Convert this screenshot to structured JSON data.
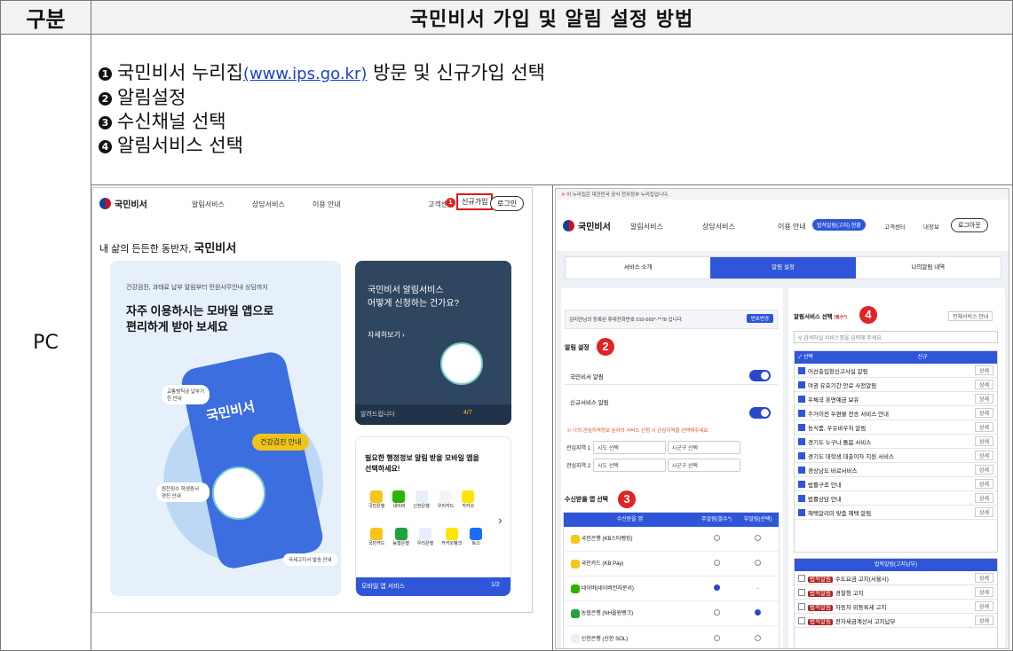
{
  "header": {
    "col1": "구분",
    "col2": "국민비서 가입 및 알림 설정 방법"
  },
  "row_label": "PC",
  "steps": [
    {
      "num": "1",
      "before": "국민비서 누리집",
      "link": "(www.ips.go.kr)",
      "after": " 방문 및 신규가입 선택"
    },
    {
      "num": "2",
      "before": "알림설정",
      "link": "",
      "after": ""
    },
    {
      "num": "3",
      "before": "수신채널 선택",
      "link": "",
      "after": ""
    },
    {
      "num": "4",
      "before": "알림서비스 선택",
      "link": "",
      "after": ""
    }
  ],
  "shot1": {
    "logo": "국민비서",
    "nav": [
      "알림서비스",
      "상담서비스",
      "이용 안내"
    ],
    "customer_center": "고객센터",
    "signup": "신규가입",
    "login": "로그인",
    "badge": "1",
    "tagline_prefix": "내 삶의 든든한 동반자, ",
    "tagline_brand": "국민비서",
    "hero_small": "건강검진, 과태료 납부 알림부터 민원사무안내 상담까지",
    "hero_line1": "자주 이용하시는 모바일 앱으로",
    "hero_line2": "편리하게 받아 보세요",
    "phone_title": "국민비서",
    "bubble_health": "건강검진 안내",
    "bubble_traffic": "교통범칙금 납부기한 안내",
    "bubble_loan": "원천징수 학생증서 경진 안내",
    "bubble_tax": "국세고지서 발송 안내",
    "dark_card_line1": "국민비서 알림서비스",
    "dark_card_line2": "어떻게 신청하는 건가요?",
    "dark_card_more": "자세히보기 ›",
    "dark_card_footer": "알려드립니다",
    "dark_card_page": "4/7",
    "apps_title1": "필요한 행정정보 알림 받을 모바일 앱을",
    "apps_title2": "선택하세요!",
    "apps_row1": [
      "국민은행",
      "네이버",
      "신한은행",
      "우리카드",
      "카카오"
    ],
    "apps_row2": [
      "국민카드",
      "농협은행",
      "우리은행",
      "카카오뱅크",
      "토스"
    ],
    "apps_footer": "모바일 앱 서비스",
    "apps_page": "1/2"
  },
  "shot2": {
    "topbar": "이 누리집은 대한민국 공식 전자정부 누리집입니다.",
    "logo": "국민비서",
    "nav": [
      "알림서비스",
      "상담서비스",
      "이용 안내"
    ],
    "notice_btn": "법적알림(고지) 현황",
    "right_nav": [
      "고객센터",
      "내정보"
    ],
    "logout": "로그아웃",
    "tabs": [
      "서비스 소개",
      "알림 설정",
      "나의알림 내역"
    ],
    "phone_info": "김미연님의 등록된 휴대전화번호 010-569*-**78 입니다.",
    "phone_change": "번호변경",
    "alarm_title": "알림 설정",
    "alarm_items": [
      "국민비서 알림",
      "신규서비스 알림"
    ],
    "badge2": "2",
    "interest_note": "※ 나의 관심지역정보 분야의 서비스 신청 시 관심지역을 선택해주세요.",
    "interest_rows": [
      {
        "label": "관심지역 1",
        "sido": "시도 선택",
        "sigungu": "시군구 선택"
      },
      {
        "label": "관심지역 2",
        "sido": "시도 선택",
        "sigungu": "시군구 선택"
      }
    ],
    "receive_title": "수신받을 앱 선택",
    "badge3": "3",
    "receive_headers": [
      "수신받을 앱",
      "주알림(필수*)",
      "부알림(선택)"
    ],
    "receive_apps": [
      "국민은행 (KB스타뱅킹)",
      "국민카드 (KB Pay)",
      "네이버(네이버전자문서)",
      "농협은행 (NH올원뱅크)",
      "신한은행 (신한 SOL)"
    ],
    "service_title": "알림서비스 선택",
    "service_required": "(필수*)",
    "badge4": "4",
    "service_guide": "전체서비스 안내",
    "search_placeholder": "검색하실 서비스명을 입력해 주세요.",
    "list_header_select": "선택",
    "list_header_new": "신규",
    "services_new": [
      "어선출입항신고사실 알림",
      "여권 유효기간 만료 사전알림",
      "우체국 휴면예금 보유",
      "주거이전 우편물 전송 서비스 안내",
      "농식품, 우유바우처 알림",
      "경기도 누구나 돌봄 서비스",
      "경기도 대학생 대출이자 지원 서비스",
      "경상남도 바로서비스",
      "법률구조 안내",
      "법률상담 안내",
      "해택알리미 맞춤 혜택 알림"
    ],
    "detail_label": "상세",
    "list2_header": "법적알림(고지납부)",
    "legal_tag": "법적알림",
    "services_legal": [
      "수도요금 고지(서울시)",
      "경찰청 고지",
      "자동차 위등록세 고지",
      "전자세금계산서 고지납부"
    ]
  }
}
